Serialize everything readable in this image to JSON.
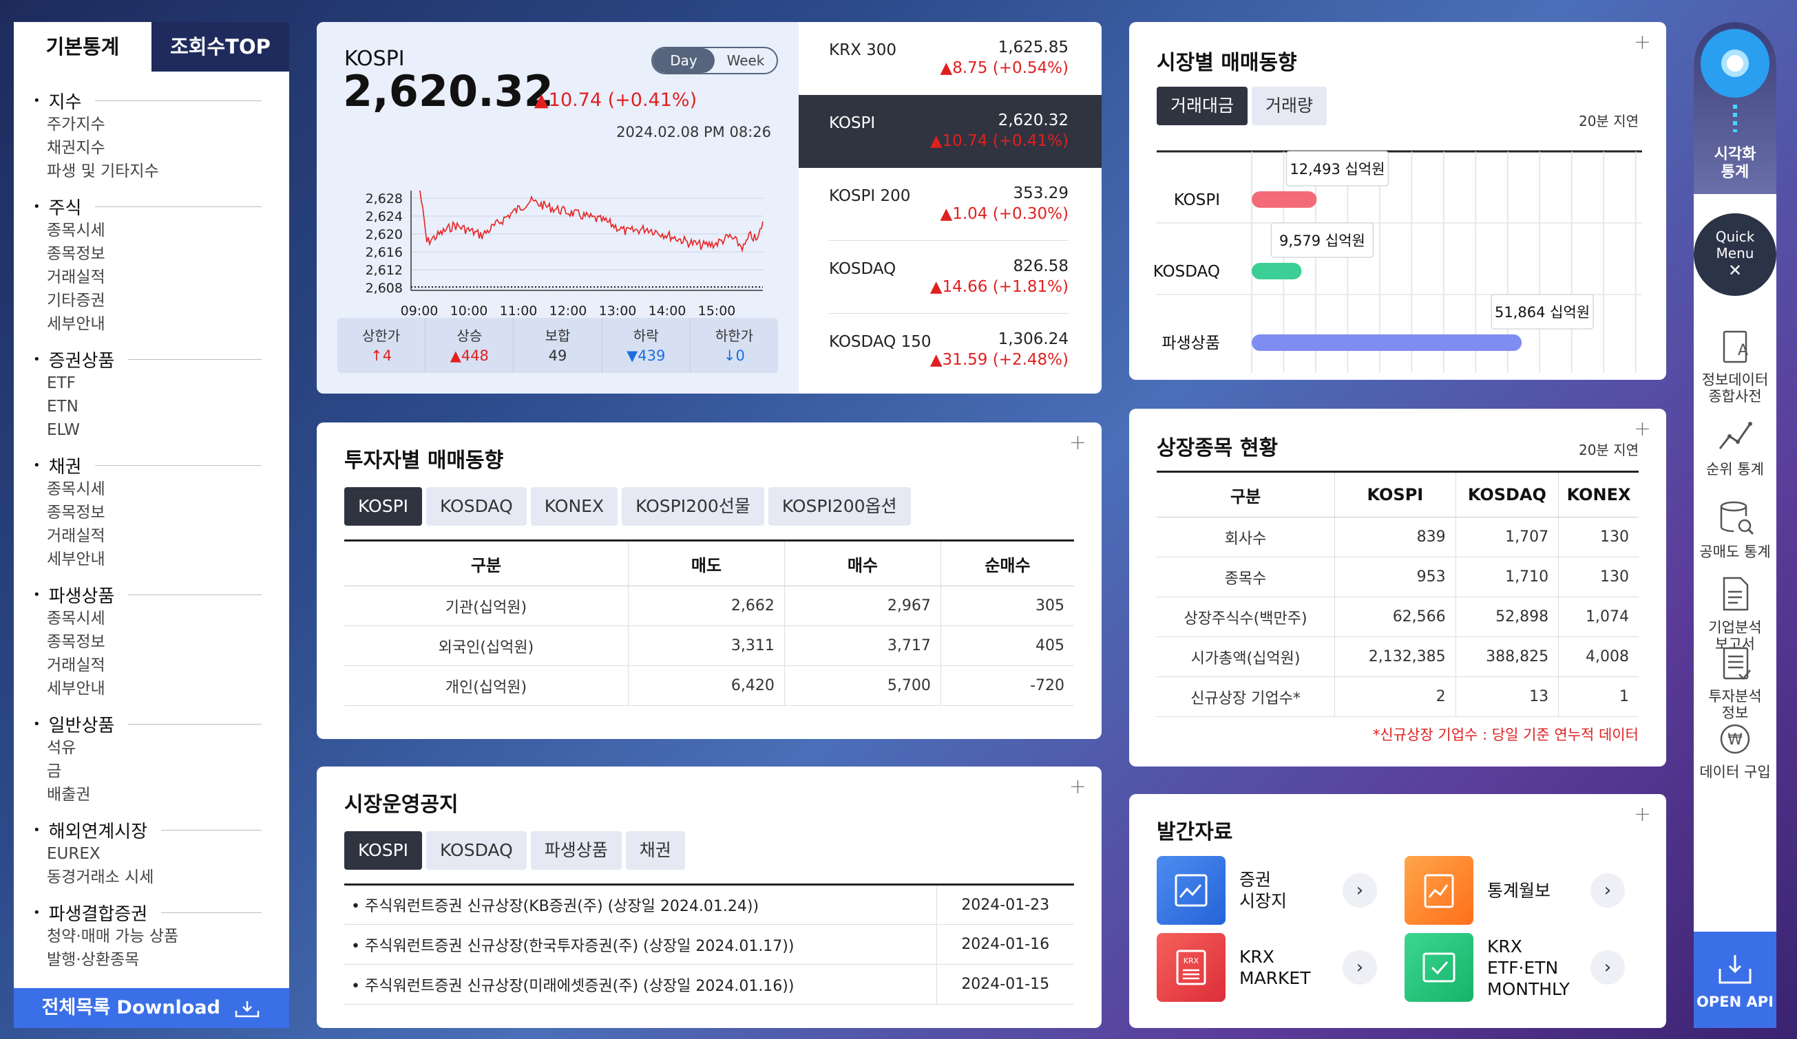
{
  "sidebar": {
    "tab_basic": "기본통계",
    "tab_top": "조회수TOP",
    "sections": [
      {
        "title": "지수",
        "items": [
          "주가지수",
          "채권지수",
          "파생 및 기타지수"
        ]
      },
      {
        "title": "주식",
        "items": [
          "종목시세",
          "종목정보",
          "거래실적",
          "기타증권",
          "세부안내"
        ]
      },
      {
        "title": "증권상품",
        "items": [
          "ETF",
          "ETN",
          "ELW"
        ]
      },
      {
        "title": "채권",
        "items": [
          "종목시세",
          "종목정보",
          "거래실적",
          "세부안내"
        ]
      },
      {
        "title": "파생상품",
        "items": [
          "종목시세",
          "종목정보",
          "거래실적",
          "세부안내"
        ]
      },
      {
        "title": "일반상품",
        "items": [
          "석유",
          "금",
          "배출권"
        ]
      },
      {
        "title": "해외연계시장",
        "items": [
          "EUREX",
          "동경거래소 시세"
        ]
      },
      {
        "title": "파생결합증권",
        "items": [
          "청약·매매 가능 상품",
          "발행·상환종목"
        ]
      }
    ],
    "download": "전체목록 Download"
  },
  "kospi": {
    "name": "KOSPI",
    "value": "2,620.32",
    "change": "▲10.74 (+0.41%)",
    "toggle_day": "Day",
    "toggle_week": "Week",
    "datetime": "2024.02.08 PM 08:26",
    "y_ticks": [
      "2,628",
      "2,624",
      "2,620",
      "2,616",
      "2,612",
      "2,608"
    ],
    "x_ticks": [
      "09:00",
      "10:00",
      "11:00",
      "12:00",
      "13:00",
      "14:00",
      "15:00"
    ],
    "stats": [
      {
        "label": "상한가",
        "value": "↑4"
      },
      {
        "label": "상승",
        "value": "▲448"
      },
      {
        "label": "보합",
        "value": "49"
      },
      {
        "label": "하락",
        "value": "▼439"
      },
      {
        "label": "하한가",
        "value": "↓0"
      }
    ],
    "indices": [
      {
        "name": "KRX 300",
        "value": "1,625.85",
        "change": "▲8.75 (+0.54%)"
      },
      {
        "name": "KOSPI",
        "value": "2,620.32",
        "change": "▲10.74 (+0.41%)"
      },
      {
        "name": "KOSPI 200",
        "value": "353.29",
        "change": "▲1.04 (+0.30%)"
      },
      {
        "name": "KOSDAQ",
        "value": "826.58",
        "change": "▲14.66 (+1.81%)"
      },
      {
        "name": "KOSDAQ 150",
        "value": "1,306.24",
        "change": "▲31.59 (+2.48%)"
      }
    ]
  },
  "trade": {
    "title": "시장별 매매동향",
    "tab_amount": "거래대금",
    "tab_volume": "거래량",
    "delay": "20분 지연",
    "plus": "+"
  },
  "chart_data": {
    "type": "bar",
    "categories": [
      "KOSPI",
      "KOSDAQ",
      "파생상품"
    ],
    "values": [
      12493,
      9579,
      51864
    ],
    "labels": [
      "12,493 십억원",
      "9,579 십억원",
      "51,864 십억원"
    ],
    "colors": [
      "#f46b78",
      "#3ccf95",
      "#7f8cf0"
    ],
    "xlim": [
      0,
      75000
    ]
  },
  "investor": {
    "title": "투자자별 매매동향",
    "tabs": [
      "KOSPI",
      "KOSDAQ",
      "KONEX",
      "KOSPI200선물",
      "KOSPI200옵션"
    ],
    "headers": [
      "구분",
      "매도",
      "매수",
      "순매수"
    ],
    "rows": [
      [
        "기관(십억원)",
        "2,662",
        "2,967",
        "305"
      ],
      [
        "외국인(십억원)",
        "3,311",
        "3,717",
        "405"
      ],
      [
        "개인(십억원)",
        "6,420",
        "5,700",
        "-720"
      ]
    ],
    "plus": "+"
  },
  "notice": {
    "title": "시장운영공지",
    "tabs": [
      "KOSPI",
      "KOSDAQ",
      "파생상품",
      "채권"
    ],
    "items": [
      {
        "text": "주식워런트증권 신규상장(KB증권(주) (상장일 2024.01.24))",
        "date": "2024-01-23"
      },
      {
        "text": "주식워런트증권 신규상장(한국투자증권(주) (상장일 2024.01.17))",
        "date": "2024-01-16"
      },
      {
        "text": "주식워런트증권 신규상장(미래에셋증권(주) (상장일 2024.01.16))",
        "date": "2024-01-15"
      }
    ],
    "plus": "+"
  },
  "listing": {
    "title": "상장종목 현황",
    "delay": "20분 지연",
    "headers": [
      "구분",
      "KOSPI",
      "KOSDAQ",
      "KONEX"
    ],
    "rows": [
      [
        "회사수",
        "839",
        "1,707",
        "130"
      ],
      [
        "종목수",
        "953",
        "1,710",
        "130"
      ],
      [
        "상장주식수(백만주)",
        "62,566",
        "52,898",
        "1,074"
      ],
      [
        "시가총액(십억원)",
        "2,132,385",
        "388,825",
        "4,008"
      ],
      [
        "신규상장 기업수*",
        "2",
        "13",
        "1"
      ]
    ],
    "footnote": "*신규상장 기업수 : 당일 기준 연누적 데이터",
    "plus": "+"
  },
  "pubs": {
    "title": "발간자료",
    "items": [
      {
        "label": "증권\n시장지"
      },
      {
        "label": "통계월보"
      },
      {
        "label": "KRX\nMARKET"
      },
      {
        "label": "KRX\nETF·ETN\nMONTHLY"
      }
    ],
    "plus": "+"
  },
  "rail": {
    "viz": "시각화\n통계",
    "quick": "Quick\nMenu",
    "items": [
      "정보데이터\n종합사전",
      "순위 통계",
      "공매도 통계",
      "기업분석\n보고서",
      "투자분석\n정보",
      "데이터 구입"
    ],
    "openapi": "OPEN API"
  }
}
